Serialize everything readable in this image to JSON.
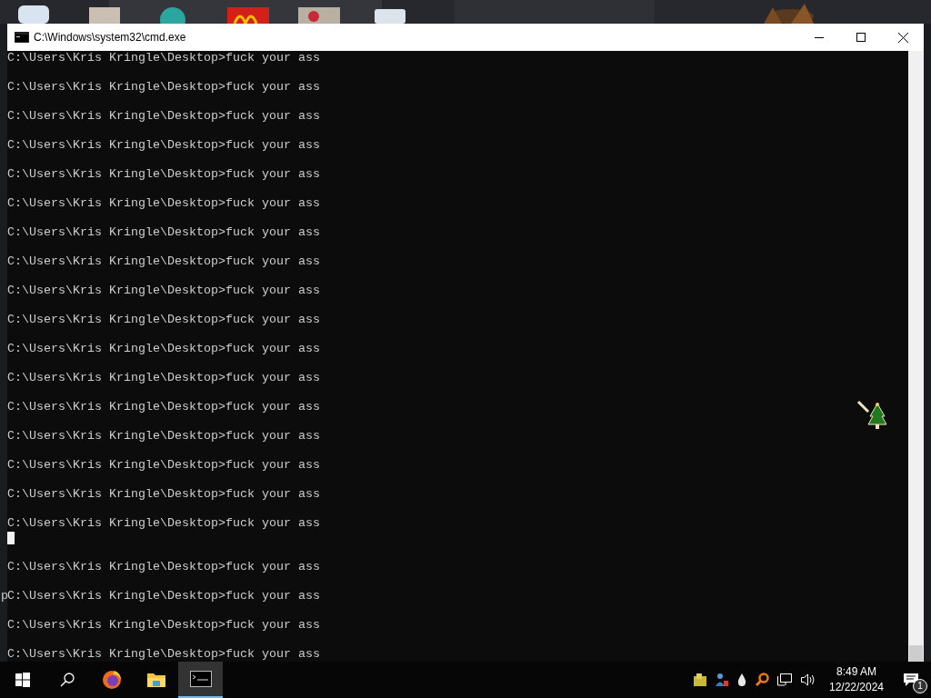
{
  "window": {
    "title": "C:\\Windows\\system32\\cmd.exe"
  },
  "console": {
    "rows": [
      {
        "kind": "text",
        "text": "C:\\Users\\Kris Kringle\\Desktop>fuck your ass"
      },
      {
        "kind": "blank"
      },
      {
        "kind": "text",
        "text": "C:\\Users\\Kris Kringle\\Desktop>fuck your ass"
      },
      {
        "kind": "blank"
      },
      {
        "kind": "text",
        "text": "C:\\Users\\Kris Kringle\\Desktop>fuck your ass"
      },
      {
        "kind": "blank"
      },
      {
        "kind": "text",
        "text": "C:\\Users\\Kris Kringle\\Desktop>fuck your ass"
      },
      {
        "kind": "blank"
      },
      {
        "kind": "text",
        "text": "C:\\Users\\Kris Kringle\\Desktop>fuck your ass"
      },
      {
        "kind": "blank"
      },
      {
        "kind": "text",
        "text": "C:\\Users\\Kris Kringle\\Desktop>fuck your ass"
      },
      {
        "kind": "blank"
      },
      {
        "kind": "text",
        "text": "C:\\Users\\Kris Kringle\\Desktop>fuck your ass"
      },
      {
        "kind": "blank"
      },
      {
        "kind": "text",
        "text": "C:\\Users\\Kris Kringle\\Desktop>fuck your ass"
      },
      {
        "kind": "blank"
      },
      {
        "kind": "text",
        "text": "C:\\Users\\Kris Kringle\\Desktop>fuck your ass"
      },
      {
        "kind": "blank"
      },
      {
        "kind": "text",
        "text": "C:\\Users\\Kris Kringle\\Desktop>fuck your ass"
      },
      {
        "kind": "blank"
      },
      {
        "kind": "text",
        "text": "C:\\Users\\Kris Kringle\\Desktop>fuck your ass"
      },
      {
        "kind": "blank"
      },
      {
        "kind": "text",
        "text": "C:\\Users\\Kris Kringle\\Desktop>fuck your ass"
      },
      {
        "kind": "blank"
      },
      {
        "kind": "text",
        "text": "C:\\Users\\Kris Kringle\\Desktop>fuck your ass"
      },
      {
        "kind": "blank"
      },
      {
        "kind": "text",
        "text": "C:\\Users\\Kris Kringle\\Desktop>fuck your ass"
      },
      {
        "kind": "blank"
      },
      {
        "kind": "text",
        "text": "C:\\Users\\Kris Kringle\\Desktop>fuck your ass"
      },
      {
        "kind": "blank"
      },
      {
        "kind": "text",
        "text": "C:\\Users\\Kris Kringle\\Desktop>fuck your ass"
      },
      {
        "kind": "blank"
      },
      {
        "kind": "text",
        "text": "C:\\Users\\Kris Kringle\\Desktop>fuck your ass"
      },
      {
        "kind": "cursor"
      },
      {
        "kind": "blank"
      },
      {
        "kind": "text",
        "text": "C:\\Users\\Kris Kringle\\Desktop>fuck your ass"
      },
      {
        "kind": "blank"
      },
      {
        "kind": "text",
        "text": "C:\\Users\\Kris Kringle\\Desktop>fuck your ass"
      },
      {
        "kind": "blank"
      },
      {
        "kind": "text",
        "text": "C:\\Users\\Kris Kringle\\Desktop>fuck your ass"
      },
      {
        "kind": "blank"
      },
      {
        "kind": "text",
        "text": "C:\\Users\\Kris Kringle\\Desktop>fuck your ass"
      }
    ]
  },
  "stray_text": "p",
  "taskbar": {
    "apps": [
      {
        "kind": "start"
      },
      {
        "kind": "search"
      },
      {
        "kind": "browser",
        "selected": false
      },
      {
        "kind": "folder",
        "selected": false
      },
      {
        "kind": "console",
        "selected": true
      }
    ],
    "clock": {
      "time": "8:49 AM",
      "date": "12/22/2024"
    },
    "notifications": {
      "count": "1"
    }
  }
}
